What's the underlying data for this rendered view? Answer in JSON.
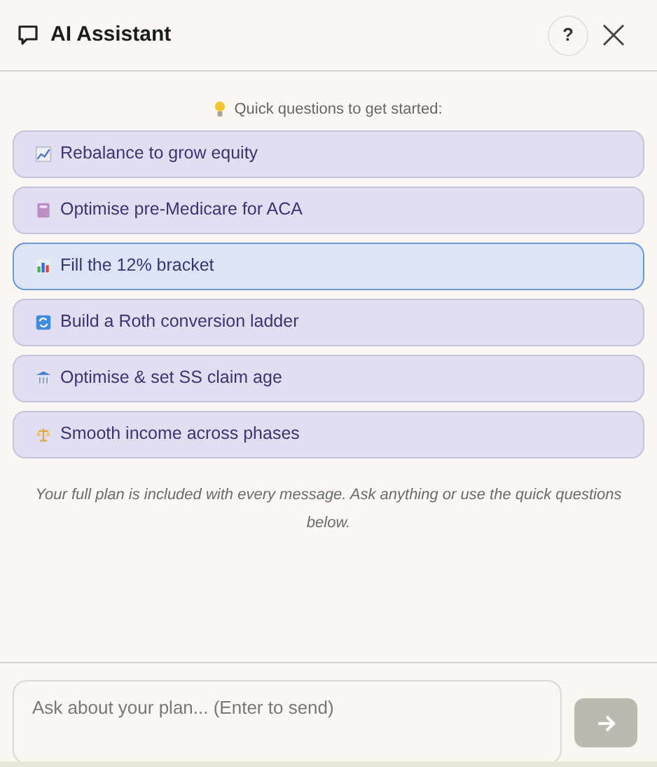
{
  "header": {
    "title": "AI Assistant",
    "help": "?"
  },
  "quick_questions": {
    "heading": "Quick questions to get started:",
    "items": [
      {
        "kind": "chart",
        "label": "Rebalance to grow equity",
        "selected": false
      },
      {
        "kind": "card",
        "label": "Optimise pre-Medicare for ACA",
        "selected": false
      },
      {
        "kind": "bars",
        "label": "Fill the 12% bracket",
        "selected": true
      },
      {
        "kind": "cycle",
        "label": "Build a Roth conversion ladder",
        "selected": false
      },
      {
        "kind": "bank",
        "label": "Optimise & set SS claim age",
        "selected": false
      },
      {
        "kind": "scale",
        "label": "Smooth income across phases",
        "selected": false
      }
    ]
  },
  "note": "Your full plan is included with every message. Ask anything or use the quick questions below.",
  "composer": {
    "placeholder": "Ask about your plan... (Enter to send)",
    "send_disabled": true
  }
}
